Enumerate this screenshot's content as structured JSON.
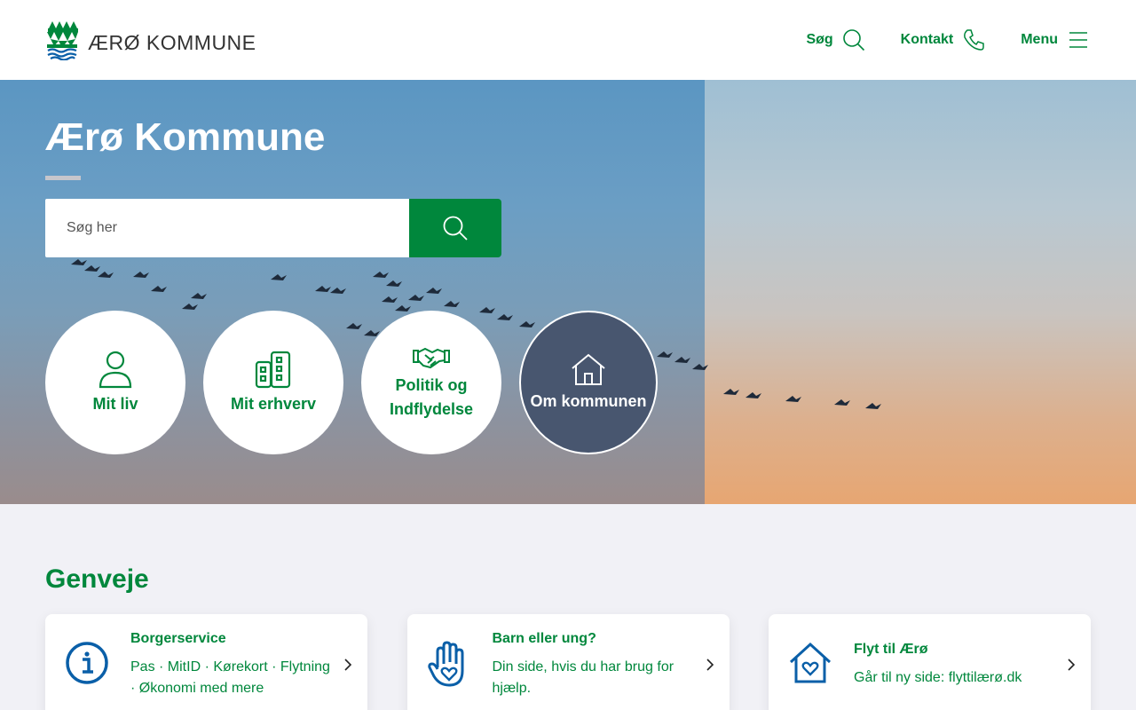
{
  "header": {
    "logo_text": "ÆRØ KOMMUNE",
    "nav": {
      "search_label": "Søg",
      "contact_label": "Kontakt",
      "menu_label": "Menu"
    }
  },
  "hero": {
    "title": "Ærø Kommune",
    "search_placeholder": "Søg her",
    "circles": [
      {
        "label": "Mit liv",
        "icon": "person-icon"
      },
      {
        "label": "Mit erhverv",
        "icon": "building-icon"
      },
      {
        "label": "Politik og Indflydelse",
        "icon": "handshake-icon"
      },
      {
        "label": "Om kommunen",
        "icon": "house-icon"
      }
    ]
  },
  "shortcuts": {
    "title": "Genveje",
    "cards": [
      {
        "title": "Borgerservice",
        "text": "Pas · MitID · Kørekort · Flytning · Økonomi med mere",
        "icon": "info-icon"
      },
      {
        "title": "Barn eller ung?",
        "text": "Din side, hvis du har brug for hjælp.",
        "icon": "heart-hand-icon"
      },
      {
        "title": "Flyt til Ærø",
        "text": "Går til ny side: flyttilærø.dk",
        "icon": "heart-house-icon"
      }
    ]
  },
  "colors": {
    "brand_green": "#00873c",
    "icon_blue": "#0a5fa8",
    "dark_circle": "#48566f"
  }
}
